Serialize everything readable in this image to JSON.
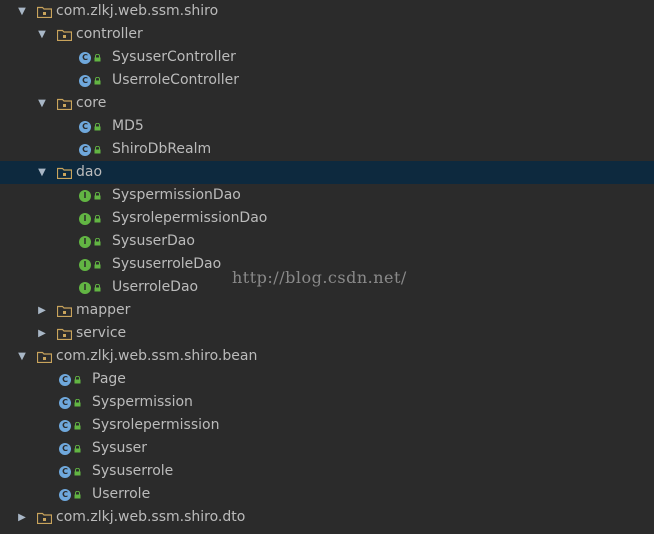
{
  "tree": {
    "root1": {
      "label": "com.zlkj.web.ssm.shiro",
      "icon": "package-folder-icon",
      "expanded": true
    },
    "controller": {
      "label": "controller",
      "icon": "package-folder-icon",
      "expanded": true,
      "items": [
        {
          "label": "SysuserController",
          "icon": "class-icon"
        },
        {
          "label": "UserroleController",
          "icon": "class-icon"
        }
      ]
    },
    "core": {
      "label": "core",
      "icon": "package-folder-icon",
      "expanded": true,
      "items": [
        {
          "label": "MD5",
          "icon": "class-icon"
        },
        {
          "label": "ShiroDbRealm",
          "icon": "class-icon"
        }
      ]
    },
    "dao": {
      "label": "dao",
      "icon": "package-folder-icon",
      "expanded": true,
      "selected": true,
      "items": [
        {
          "label": "SyspermissionDao",
          "icon": "interface-icon"
        },
        {
          "label": "SysrolepermissionDao",
          "icon": "interface-icon"
        },
        {
          "label": "SysuserDao",
          "icon": "interface-icon"
        },
        {
          "label": "SysuserroleDao",
          "icon": "interface-icon"
        },
        {
          "label": "UserroleDao",
          "icon": "interface-icon"
        }
      ]
    },
    "mapper": {
      "label": "mapper",
      "icon": "package-folder-icon",
      "expanded": false
    },
    "service": {
      "label": "service",
      "icon": "package-folder-icon",
      "expanded": false
    },
    "root2": {
      "label": "com.zlkj.web.ssm.shiro.bean",
      "icon": "package-folder-icon",
      "expanded": true,
      "items": [
        {
          "label": "Page",
          "icon": "class-icon"
        },
        {
          "label": "Syspermission",
          "icon": "class-icon"
        },
        {
          "label": "Sysrolepermission",
          "icon": "class-icon"
        },
        {
          "label": "Sysuser",
          "icon": "class-icon"
        },
        {
          "label": "Sysuserrole",
          "icon": "class-icon"
        },
        {
          "label": "Userrole",
          "icon": "class-icon"
        }
      ]
    },
    "root3": {
      "label": "com.zlkj.web.ssm.shiro.dto",
      "icon": "package-folder-icon",
      "expanded": false
    }
  },
  "badges": {
    "class_letter": "C",
    "interface_letter": "I"
  },
  "arrows": {
    "expanded": "▼",
    "collapsed": "▶"
  },
  "watermark": "http://blog.csdn.net/",
  "colors": {
    "background": "#2b2b2b",
    "selected_row": "#0d293e",
    "text": "#bbbbbb",
    "folder": "#c9a45c",
    "class_badge": "#6fa8dc",
    "interface_badge": "#62b543",
    "lock": "#62b543"
  }
}
